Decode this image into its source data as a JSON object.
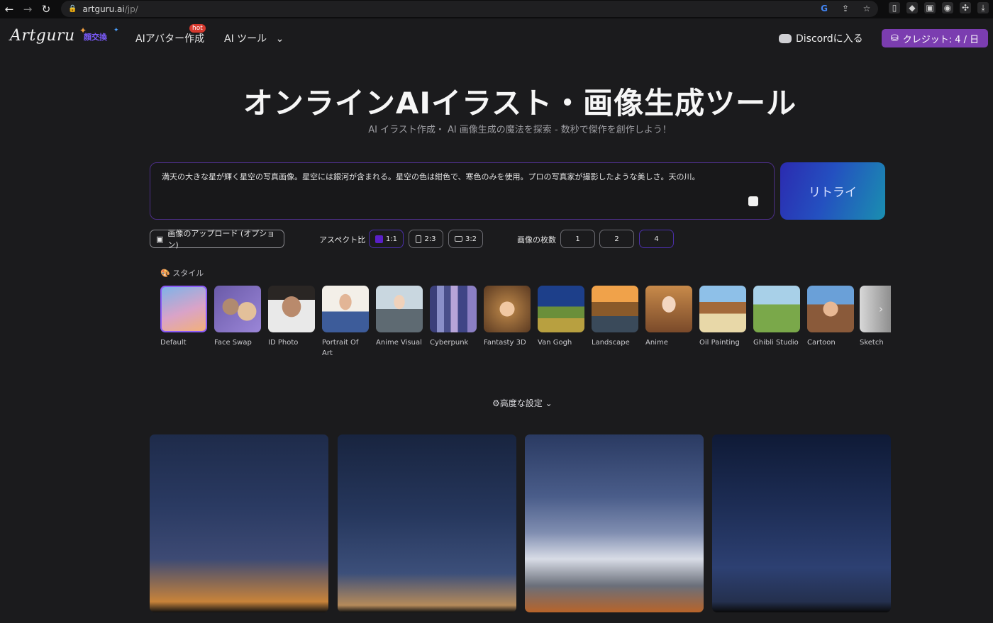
{
  "browser": {
    "url_host": "artguru.ai",
    "url_path": "/jp/",
    "icons": [
      "back-icon",
      "forward-icon",
      "reload-icon",
      "lock-icon",
      "google-icon",
      "share-icon",
      "star-icon"
    ],
    "extensions": [
      "bookmark-ext-icon",
      "ext-icon-2",
      "ext-icon-3",
      "ext-icon-4",
      "puzzle-icon",
      "download-icon"
    ]
  },
  "header": {
    "logo": "Artguru",
    "new_badge": "顔交換",
    "nav": {
      "avatar": "AIアバター作成",
      "hot": "hot",
      "tools": "AI ツール"
    },
    "discord": "Discordに入る",
    "credit": "クレジット: 4 / 日"
  },
  "hero": {
    "title": "オンラインAIイラスト・画像生成ツール",
    "subtitle": "AI イラスト作成・ AI 画像生成の魔法を探索 - 数秒で傑作を創作しよう！"
  },
  "prompt": {
    "text": "満天の大きな星が輝く星空の写真画像。星空には銀河が含まれる。星空の色は紺色で、寒色のみを使用。プロの写真家が撮影したような美しさ。天の川。",
    "retry": "リトライ"
  },
  "options": {
    "upload": "画像のアップロード (オプション)",
    "aspect_label": "アスペクト比",
    "aspect": [
      "1:1",
      "2:3",
      "3:2"
    ],
    "count_label": "画像の枚数",
    "counts": [
      "1",
      "2",
      "4"
    ]
  },
  "styles": {
    "heading": "スタイル",
    "items": [
      {
        "label": "Default"
      },
      {
        "label": "Face Swap"
      },
      {
        "label": "ID Photo"
      },
      {
        "label": "Portrait Of Art"
      },
      {
        "label": "Anime Visual"
      },
      {
        "label": "Cyberpunk"
      },
      {
        "label": "Fantasty 3D"
      },
      {
        "label": "Van Gogh"
      },
      {
        "label": "Landscape"
      },
      {
        "label": "Anime"
      },
      {
        "label": "Oil Painting"
      },
      {
        "label": "Ghibli Studio"
      },
      {
        "label": "Cartoon"
      },
      {
        "label": "Sketch"
      }
    ]
  },
  "advanced": "高度な設定",
  "colors": {
    "accent": "#7b3db0",
    "border_active": "#4b2e86"
  }
}
